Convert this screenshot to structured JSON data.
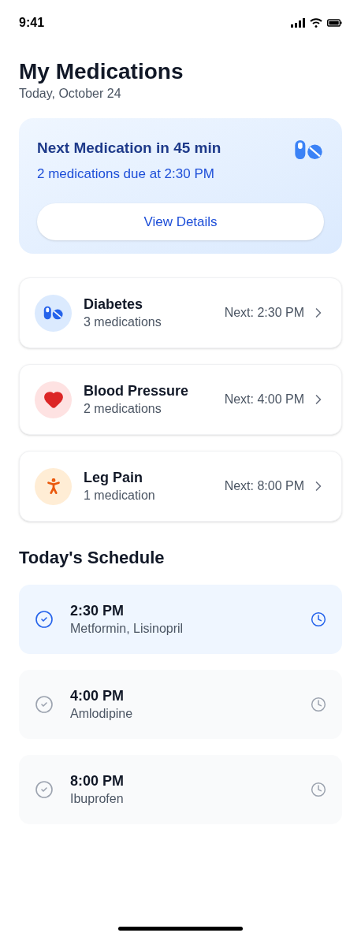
{
  "status_bar": {
    "time": "9:41"
  },
  "header": {
    "title": "My Medications",
    "date": "Today, October 24"
  },
  "next_card": {
    "title": "Next Medication in 45 min",
    "subtitle": "2 medications due at 2:30 PM",
    "button": "View Details"
  },
  "conditions": [
    {
      "kind": "pills",
      "name": "Diabetes",
      "count": "3 medications",
      "next": "Next: 2:30 PM"
    },
    {
      "kind": "heart",
      "name": "Blood Pressure",
      "count": "2 medications",
      "next": "Next: 4:00 PM"
    },
    {
      "kind": "walk",
      "name": "Leg Pain",
      "count": "1 medication",
      "next": "Next: 8:00 PM"
    }
  ],
  "schedule": {
    "title": "Today's Schedule",
    "items": [
      {
        "time": "2:30 PM",
        "meds": "Metformin, Lisinopril",
        "selected": true
      },
      {
        "time": "4:00 PM",
        "meds": "Amlodipine",
        "selected": false
      },
      {
        "time": "8:00 PM",
        "meds": "Ibuprofen",
        "selected": false
      }
    ]
  }
}
